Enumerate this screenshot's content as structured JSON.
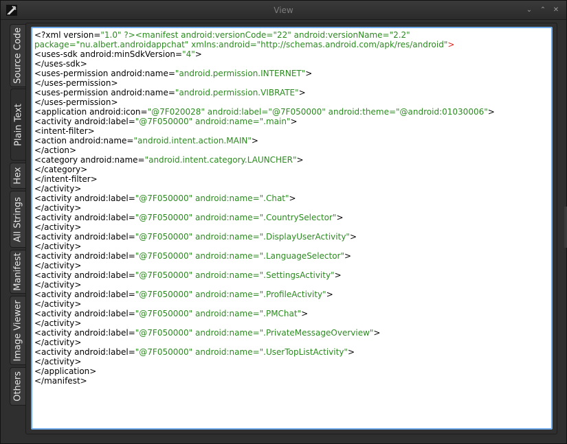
{
  "window": {
    "title": "View",
    "app_icon": "tool-icon",
    "controls": {
      "minimize": "minimize-icon",
      "maximize": "maximize-icon",
      "close": "close-icon"
    }
  },
  "tabs": [
    {
      "label": "Source Code"
    },
    {
      "label": "Plain Text",
      "active": true
    },
    {
      "label": "Hex"
    },
    {
      "label": "All Strings"
    },
    {
      "label": "Manifest"
    },
    {
      "label": "Image Viewer"
    },
    {
      "label": "Others"
    }
  ],
  "colors": {
    "value": "#2b8a1f",
    "error": "#e0241b",
    "focus_border": "#6ea8e8"
  },
  "code_lines": [
    [
      {
        "t": "<?xml version="
      },
      {
        "t": "\"1.0\" ?><manifest android:versionCode=\"22\" android:versionName=\"2.2\"",
        "c": "v"
      }
    ],
    [
      {
        "t": "package=\"nu.albert.androidappchat\" xmlns:android=\"http://schemas.android.com/apk/res/android\"",
        "c": "v"
      },
      {
        "t": ">",
        "c": "r"
      }
    ],
    [
      {
        "t": "<uses-sdk android:minSdkVersion="
      },
      {
        "t": "\"4\"",
        "c": "v"
      },
      {
        "t": ">"
      }
    ],
    [
      {
        "t": "</uses-sdk>"
      }
    ],
    [
      {
        "t": "<uses-permission android:name="
      },
      {
        "t": "\"android.permission.INTERNET\"",
        "c": "v"
      },
      {
        "t": ">"
      }
    ],
    [
      {
        "t": "</uses-permission>"
      }
    ],
    [
      {
        "t": "<uses-permission android:name="
      },
      {
        "t": "\"android.permission.VIBRATE\"",
        "c": "v"
      },
      {
        "t": ">"
      }
    ],
    [
      {
        "t": "</uses-permission>"
      }
    ],
    [
      {
        "t": "<application android:icon="
      },
      {
        "t": "\"@7F020028\" android:label=\"@7F050000\" android:theme=\"@android:01030006\"",
        "c": "v"
      },
      {
        "t": ">"
      }
    ],
    [
      {
        "t": "<activity android:label="
      },
      {
        "t": "\"@7F050000\" android:name=\".main\"",
        "c": "v"
      },
      {
        "t": ">"
      }
    ],
    [
      {
        "t": "<intent-filter>"
      }
    ],
    [
      {
        "t": "<action android:name="
      },
      {
        "t": "\"android.intent.action.MAIN\"",
        "c": "v"
      },
      {
        "t": ">"
      }
    ],
    [
      {
        "t": "</action>"
      }
    ],
    [
      {
        "t": "<category android:name="
      },
      {
        "t": "\"android.intent.category.LAUNCHER\"",
        "c": "v"
      },
      {
        "t": ">"
      }
    ],
    [
      {
        "t": "</category>"
      }
    ],
    [
      {
        "t": "</intent-filter>"
      }
    ],
    [
      {
        "t": "</activity>"
      }
    ],
    [
      {
        "t": "<activity android:label="
      },
      {
        "t": "\"@7F050000\" android:name=\".Chat\"",
        "c": "v"
      },
      {
        "t": ">"
      }
    ],
    [
      {
        "t": "</activity>"
      }
    ],
    [
      {
        "t": "<activity android:label="
      },
      {
        "t": "\"@7F050000\" android:name=\".CountrySelector\"",
        "c": "v"
      },
      {
        "t": ">"
      }
    ],
    [
      {
        "t": "</activity>"
      }
    ],
    [
      {
        "t": "<activity android:label="
      },
      {
        "t": "\"@7F050000\" android:name=\".DisplayUserActivity\"",
        "c": "v"
      },
      {
        "t": ">"
      }
    ],
    [
      {
        "t": "</activity>"
      }
    ],
    [
      {
        "t": "<activity android:label="
      },
      {
        "t": "\"@7F050000\" android:name=\".LanguageSelector\"",
        "c": "v"
      },
      {
        "t": ">"
      }
    ],
    [
      {
        "t": "</activity>"
      }
    ],
    [
      {
        "t": "<activity android:label="
      },
      {
        "t": "\"@7F050000\" android:name=\".SettingsActivity\"",
        "c": "v"
      },
      {
        "t": ">"
      }
    ],
    [
      {
        "t": "</activity>"
      }
    ],
    [
      {
        "t": "<activity android:label="
      },
      {
        "t": "\"@7F050000\" android:name=\".ProfileActivity\"",
        "c": "v"
      },
      {
        "t": ">"
      }
    ],
    [
      {
        "t": "</activity>"
      }
    ],
    [
      {
        "t": "<activity android:label="
      },
      {
        "t": "\"@7F050000\" android:name=\".PMChat\"",
        "c": "v"
      },
      {
        "t": ">"
      }
    ],
    [
      {
        "t": "</activity>"
      }
    ],
    [
      {
        "t": "<activity android:label="
      },
      {
        "t": "\"@7F050000\" android:name=\".PrivateMessageOverview\"",
        "c": "v"
      },
      {
        "t": ">"
      }
    ],
    [
      {
        "t": "</activity>"
      }
    ],
    [
      {
        "t": "<activity android:label="
      },
      {
        "t": "\"@7F050000\" android:name=\".UserTopListActivity\"",
        "c": "v"
      },
      {
        "t": ">"
      }
    ],
    [
      {
        "t": "</activity>"
      }
    ],
    [
      {
        "t": "</application>"
      }
    ],
    [
      {
        "t": "</manifest>"
      }
    ]
  ]
}
